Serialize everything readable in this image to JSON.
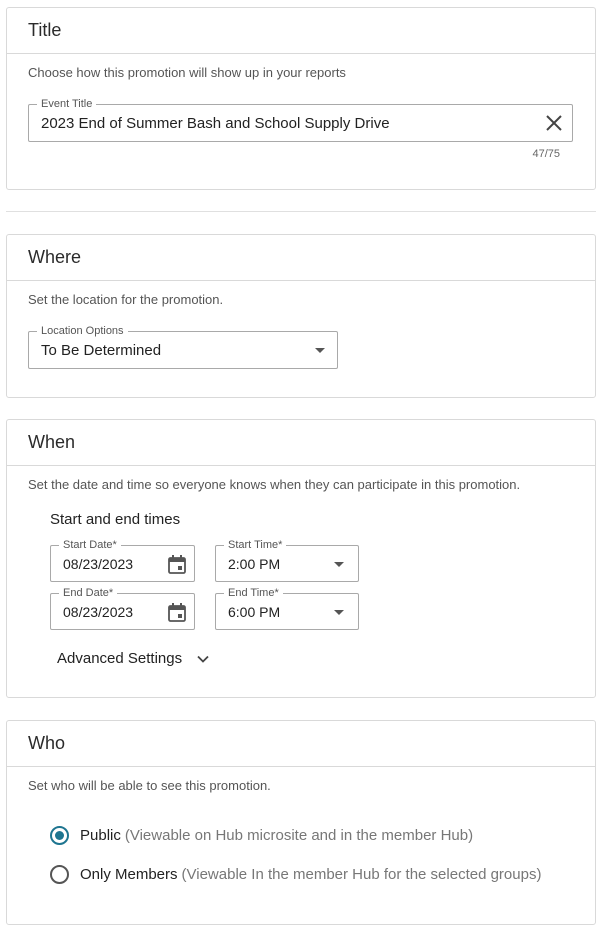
{
  "title_section": {
    "heading": "Title",
    "description": "Choose how this promotion will show up in your reports",
    "event_title": {
      "label": "Event Title",
      "value": "2023 End of Summer Bash and School Supply Drive",
      "counter": "47/75",
      "clear_icon": "close-icon"
    }
  },
  "where_section": {
    "heading": "Where",
    "description": "Set the location for the promotion.",
    "location": {
      "label": "Location Options",
      "value": "To Be Determined",
      "icon": "caret-down-icon"
    }
  },
  "when_section": {
    "heading": "When",
    "description": "Set the date and time so everyone knows when they can participate in this promotion.",
    "subheading": "Start and end times",
    "start_date": {
      "label": "Start Date",
      "required_mark": "*",
      "value": "08/23/2023",
      "icon": "calendar-icon"
    },
    "start_time": {
      "label": "Start Time",
      "required_mark": "*",
      "value": "2:00 PM",
      "icon": "caret-down-icon"
    },
    "end_date": {
      "label": "End Date",
      "required_mark": "*",
      "value": "08/23/2023",
      "icon": "calendar-icon"
    },
    "end_time": {
      "label": "End Time",
      "required_mark": "*",
      "value": "6:00 PM",
      "icon": "caret-down-icon"
    },
    "advanced_settings": {
      "label": "Advanced Settings",
      "icon": "chevron-down-icon"
    }
  },
  "who_section": {
    "heading": "Who",
    "description": "Set who will be able to see this promotion.",
    "options": [
      {
        "label": "Public",
        "detail": "(Viewable on Hub microsite and in the member Hub)",
        "selected": true
      },
      {
        "label": "Only Members",
        "detail": "(Viewable In the member Hub for the selected groups)",
        "selected": false
      }
    ]
  },
  "colors": {
    "accent": "#1e7590",
    "border": "#d9d9d9",
    "input_border": "#a9a9a9"
  }
}
